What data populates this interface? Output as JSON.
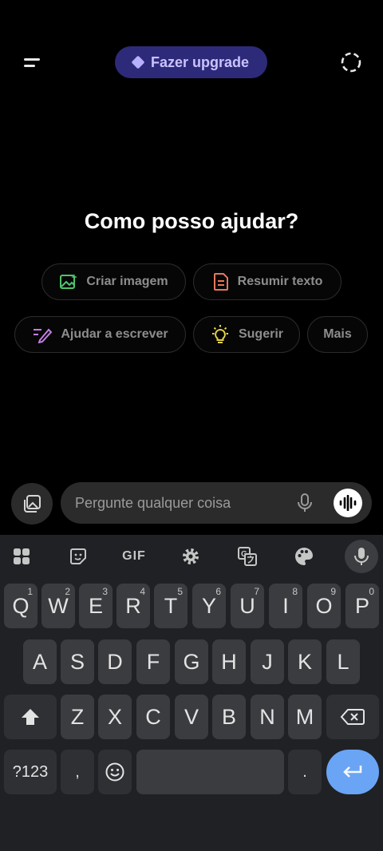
{
  "header": {
    "upgrade_label": "Fazer upgrade"
  },
  "main": {
    "heading": "Como posso ajudar?",
    "suggestions": [
      {
        "label": "Criar imagem",
        "icon": "image-create-icon",
        "color": "#4fc36a"
      },
      {
        "label": "Resumir texto",
        "icon": "document-icon",
        "color": "#e8775a"
      },
      {
        "label": "Ajudar a escrever",
        "icon": "pen-write-icon",
        "color": "#c27ee3"
      },
      {
        "label": "Sugerir",
        "icon": "lightbulb-icon",
        "color": "#e6d548"
      },
      {
        "label": "Mais",
        "icon": "",
        "color": ""
      }
    ]
  },
  "composer": {
    "placeholder": "Pergunte qualquer coisa"
  },
  "keyboard": {
    "toolbar": {
      "gif_label": "GIF",
      "icons": [
        "apps-grid-icon",
        "sticker-icon",
        "gif-icon",
        "settings-icon",
        "translate-icon",
        "palette-icon",
        "mic-icon"
      ]
    },
    "row1": [
      {
        "key": "Q",
        "hint": "1"
      },
      {
        "key": "W",
        "hint": "2"
      },
      {
        "key": "E",
        "hint": "3"
      },
      {
        "key": "R",
        "hint": "4"
      },
      {
        "key": "T",
        "hint": "5"
      },
      {
        "key": "Y",
        "hint": "6"
      },
      {
        "key": "U",
        "hint": "7"
      },
      {
        "key": "I",
        "hint": "8"
      },
      {
        "key": "O",
        "hint": "9"
      },
      {
        "key": "P",
        "hint": "0"
      }
    ],
    "row2": [
      "A",
      "S",
      "D",
      "F",
      "G",
      "H",
      "J",
      "K",
      "L"
    ],
    "row3": [
      "Z",
      "X",
      "C",
      "V",
      "B",
      "N",
      "M"
    ],
    "symbols_label": "?123",
    "comma": ",",
    "period": "."
  },
  "colors": {
    "background": "#000000",
    "upgrade_bg": "#2e2a7a",
    "upgrade_text": "#c9c3ff",
    "keyboard_bg": "#202124",
    "key_bg": "#3b3c3f",
    "enter_bg": "#6aa4f5"
  }
}
